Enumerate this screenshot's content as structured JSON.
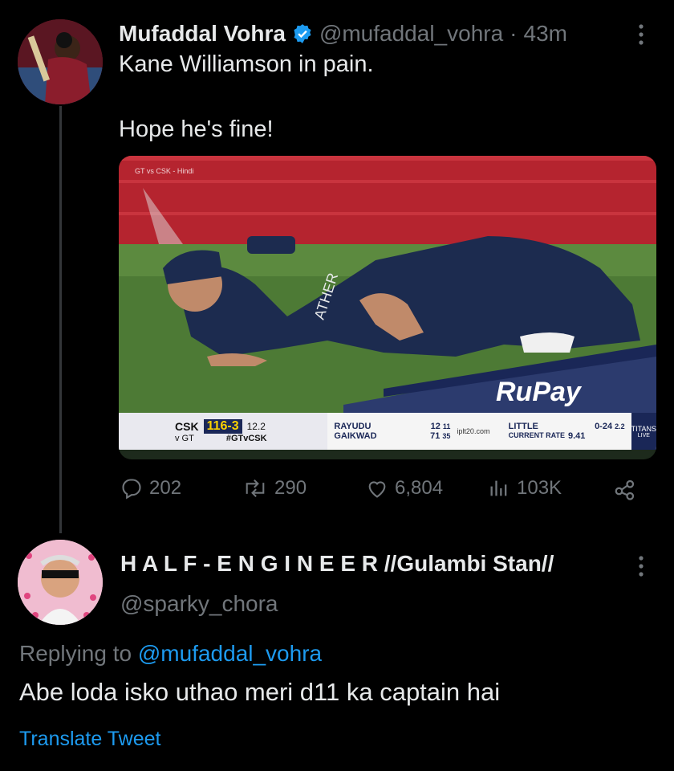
{
  "tweet": {
    "author_name": "Mufaddal Vohra",
    "handle": "@mufaddal_vohra",
    "separator": "·",
    "time": "43m",
    "line1": "Kane Williamson in pain.",
    "line2": "Hope he's fine!",
    "stats": {
      "replies": "202",
      "retweets": "290",
      "likes": "6,804",
      "views": "103K"
    }
  },
  "video": {
    "channel_label": "GT vs CSK - Hindi",
    "jersey_text": "ATHER",
    "sponsor": "RuPay",
    "scorebar": {
      "team": "CSK",
      "score": "116-3",
      "overs": "12.2",
      "vs": "v GT",
      "hashtag": "#GTvCSK",
      "batter1": "RAYUDU",
      "batter1_runs": "12",
      "batter1_balls": "11",
      "batter2": "GAIKWAD",
      "batter2_runs": "71",
      "batter2_balls": "35",
      "site": "iplt20.com",
      "bowler": "LITTLE",
      "bowler_figures": "0-24",
      "bowler_overs": "2.2",
      "rate_label": "CURRENT RATE",
      "rate": "9.41",
      "badge": "TITANS",
      "live": "LIVE"
    }
  },
  "reply": {
    "author_name": "H A L F - E N G I N E E R //Gulambi Stan//",
    "handle": "@sparky_chora",
    "replying_prefix": "Replying to",
    "replying_handle": "@mufaddal_vohra",
    "text": "Abe loda isko uthao meri d11 ka captain hai",
    "translate": "Translate Tweet"
  },
  "colors": {
    "link": "#1d9bf0",
    "verified": "#1d9bf0",
    "muted": "#71767b",
    "text": "#e7e9ea"
  },
  "icons": [
    "verified-badge-icon",
    "more-icon",
    "reply-icon",
    "retweet-icon",
    "like-icon",
    "views-icon",
    "share-icon"
  ]
}
